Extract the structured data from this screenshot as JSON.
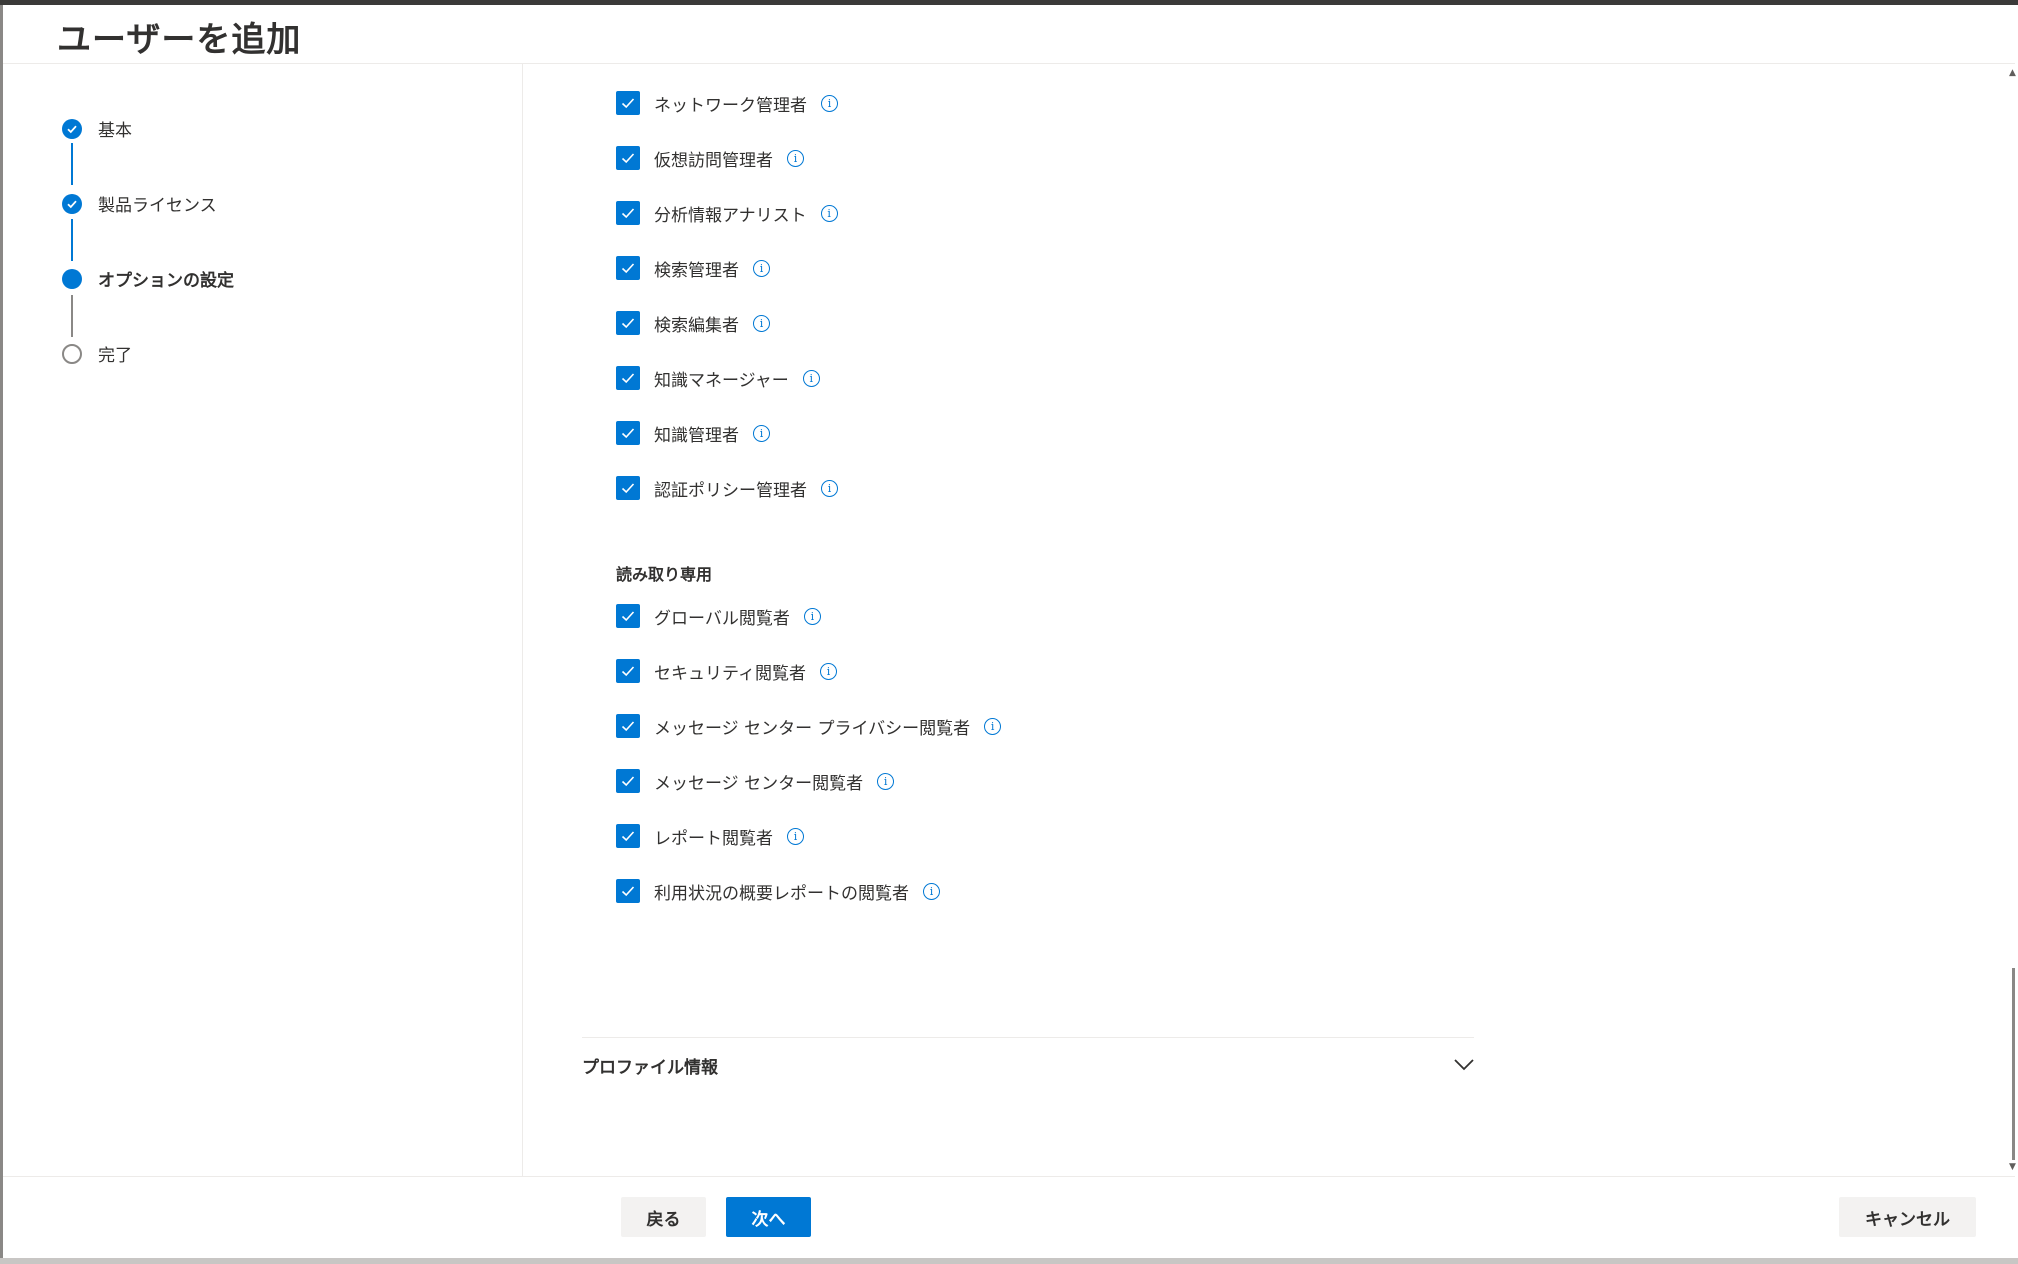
{
  "header": {
    "title": "ユーザーを追加"
  },
  "stepper": {
    "steps": [
      {
        "label": "基本",
        "state": "done"
      },
      {
        "label": "製品ライセンス",
        "state": "done"
      },
      {
        "label": "オプションの設定",
        "state": "current"
      },
      {
        "label": "完了",
        "state": "todo"
      }
    ]
  },
  "roles": {
    "admin": [
      {
        "label": "ネットワーク管理者",
        "checked": true
      },
      {
        "label": "仮想訪問管理者",
        "checked": true
      },
      {
        "label": "分析情報アナリスト",
        "checked": true
      },
      {
        "label": "検索管理者",
        "checked": true
      },
      {
        "label": "検索編集者",
        "checked": true
      },
      {
        "label": "知識マネージャー",
        "checked": true
      },
      {
        "label": "知識管理者",
        "checked": true
      },
      {
        "label": "認証ポリシー管理者",
        "checked": true
      }
    ],
    "readonly_heading": "読み取り専用",
    "readonly": [
      {
        "label": "グローバル閲覧者",
        "checked": true
      },
      {
        "label": "セキュリティ閲覧者",
        "checked": true
      },
      {
        "label": "メッセージ センター プライバシー閲覧者",
        "checked": true
      },
      {
        "label": "メッセージ センター閲覧者",
        "checked": true
      },
      {
        "label": "レポート閲覧者",
        "checked": true
      },
      {
        "label": "利用状況の概要レポートの閲覧者",
        "checked": true
      }
    ]
  },
  "profile": {
    "label": "プロファイル情報"
  },
  "footer": {
    "back_label": "戻る",
    "next_label": "次へ",
    "cancel_label": "キャンセル"
  },
  "colors": {
    "accent": "#0078d4",
    "neutral_button": "#f3f2f1",
    "text": "#323130"
  }
}
